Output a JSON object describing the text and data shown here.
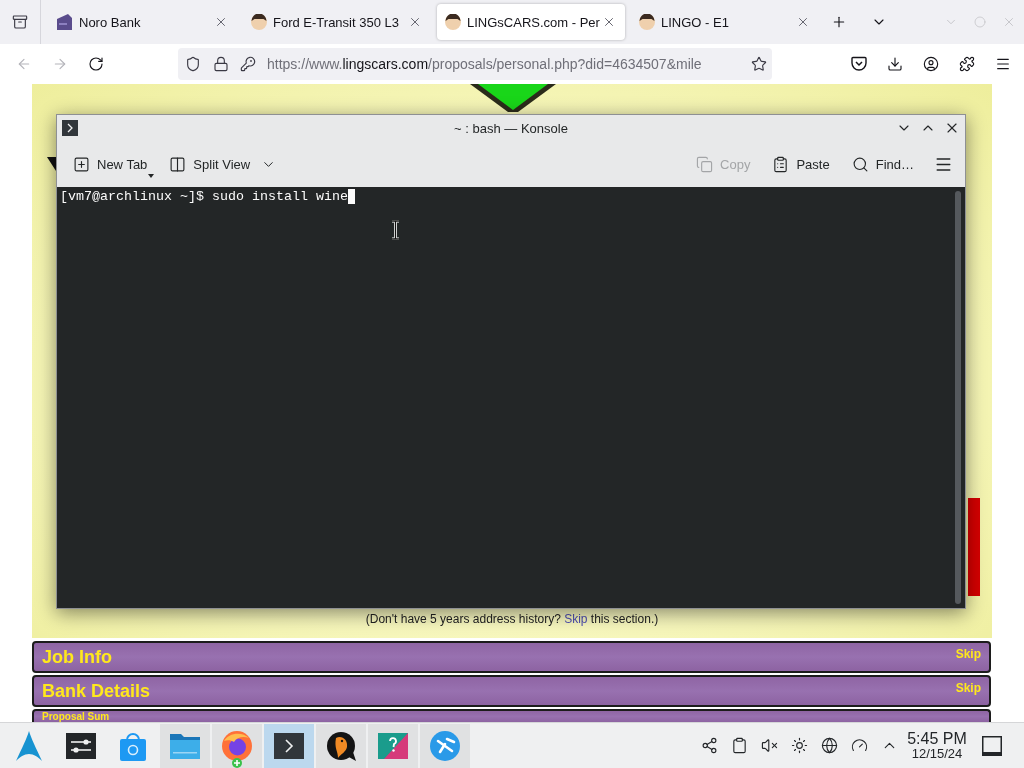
{
  "browser": {
    "tabs": [
      {
        "title": "Noro Bank",
        "kind": "card",
        "selected": false
      },
      {
        "title": "Ford E-Transit 350 L3",
        "kind": "avatar",
        "selected": false
      },
      {
        "title": "LINGsCARS.com - Per",
        "kind": "avatar",
        "selected": true
      },
      {
        "title": "LINGO - E1",
        "kind": "avatar",
        "selected": false
      }
    ],
    "navigation": {
      "back_disabled": true,
      "forward_disabled": true
    },
    "url": {
      "prefix": "https://www.",
      "domain": "lingscars.com",
      "path": "/proposals/personal.php?did=4634507&mile"
    }
  },
  "konsole": {
    "title": "~ : bash — Konsole",
    "toolbar": {
      "left": [
        {
          "label": "New Tab",
          "kind": "new-tab",
          "disabled": false,
          "dropdown": true
        },
        {
          "label": "Split View",
          "kind": "split",
          "disabled": false,
          "dropdown": true
        }
      ],
      "right": [
        {
          "label": "Copy",
          "kind": "copy",
          "disabled": true,
          "dropdown": false
        },
        {
          "label": "Paste",
          "kind": "paste",
          "disabled": false,
          "dropdown": false
        },
        {
          "label": "Find…",
          "kind": "find",
          "disabled": false,
          "dropdown": false
        }
      ]
    },
    "lines": [
      "[vm7@archlinux ~]$ sudo install wine"
    ]
  },
  "page": {
    "note": {
      "before": "(Don't have 5 years address history? ",
      "link": "Skip",
      "after": " this section.)"
    },
    "sections": [
      {
        "title": "Job Info",
        "skip": "Skip"
      },
      {
        "title": "Bank Details",
        "skip": "Skip"
      },
      {
        "title": "Proposal Sum"
      }
    ]
  },
  "taskbar": {
    "apps": [
      {
        "kind": "launcher",
        "running": false,
        "selected": false,
        "badge": false
      },
      {
        "kind": "settings",
        "running": false,
        "selected": false,
        "badge": false
      },
      {
        "kind": "store",
        "running": false,
        "selected": false,
        "badge": false
      },
      {
        "kind": "files",
        "running": true,
        "selected": false,
        "badge": false
      },
      {
        "kind": "browser",
        "running": true,
        "selected": false,
        "badge": true
      },
      {
        "kind": "terminal",
        "running": true,
        "selected": true,
        "badge": false
      },
      {
        "kind": "chat",
        "running": true,
        "selected": false,
        "badge": false
      },
      {
        "kind": "help",
        "running": true,
        "selected": false,
        "badge": false
      },
      {
        "kind": "connect",
        "running": true,
        "selected": false,
        "badge": false
      }
    ],
    "tray": {
      "muted": true
    },
    "clock": {
      "time": "5:45 PM",
      "date": "12/15/24"
    }
  }
}
